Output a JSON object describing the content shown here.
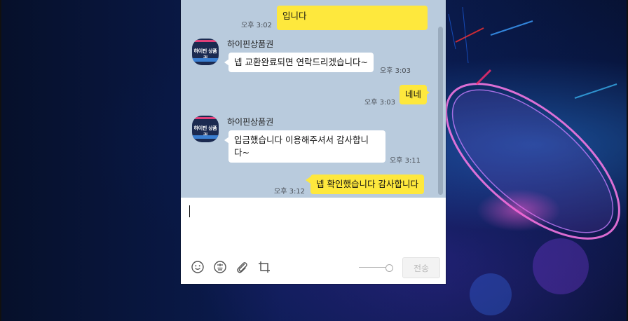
{
  "messages": [
    {
      "from": "me",
      "text": "입니다",
      "time": "오후 3:02"
    },
    {
      "from": "them",
      "sender": "하이핀상품권",
      "text": "넵 교환완료되면 연락드리겠습니다~",
      "time": "오후 3:03"
    },
    {
      "from": "me",
      "text": "네네",
      "time": "오후 3:03"
    },
    {
      "from": "them",
      "sender": "하이핀상품권",
      "text_lines": [
        "입금했습니다 이용해주셔서 감사합니",
        "다~"
      ],
      "time": "오후 3:11"
    },
    {
      "from": "me",
      "text": "넵 확인했습니다 감사합니다",
      "time": "오후 3:12"
    }
  ],
  "avatar": {
    "brand_text": "하이핀 상품권",
    "bg_color": "#1b2a50",
    "accent_color": "#e0407a"
  },
  "input": {
    "value": ""
  },
  "toolbar": {
    "icons": [
      "emoji-icon",
      "emoticon-tab-icon",
      "paperclip-icon",
      "crop-icon"
    ],
    "send_label": "전송"
  },
  "colors": {
    "chat_bg": "#b9cbdd",
    "my_bubble": "#fee83d",
    "their_bubble": "#ffffff"
  }
}
